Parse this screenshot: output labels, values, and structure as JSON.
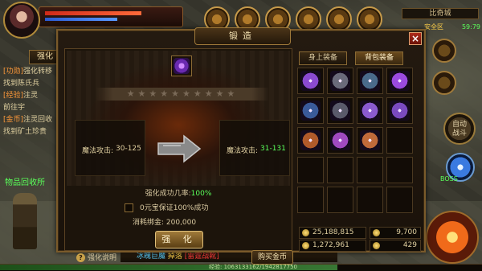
{
  "hud": {
    "map_name": "比奇城",
    "zone_label": "安全区",
    "coords": "59:79",
    "fight_label_1": "自动",
    "fight_label_2": "战斗",
    "pet_text": "BOSS",
    "item_recycle": "物品回收所"
  },
  "quest_panel": {
    "tab_label": "强化",
    "lines": [
      {
        "tag": "[功勋]",
        "text": "强化转移"
      },
      {
        "tag": "",
        "text": "找到陈氏兵"
      },
      {
        "tag": "[经验]",
        "text": "注灵"
      },
      {
        "tag": "",
        "text": "前往宇"
      },
      {
        "tag": "[金币]",
        "text": "注灵回收"
      },
      {
        "tag": "",
        "text": "找到矿土珍贵"
      }
    ],
    "side_tabs": [
      "强化转移",
      "注灵",
      "注灵回收"
    ]
  },
  "bottom": {
    "loot_a": "冰魄巨魔",
    "loot_b": "掉落",
    "loot_c": "[雷霆战靴]",
    "exp_text": "经验: 1063133162/1942817750"
  },
  "forge": {
    "title": "锻造",
    "close": "×",
    "stars": "★★★★★★★★★★",
    "stat_left_label": "魔法攻击:",
    "stat_left_value": "30-125",
    "stat_right_label": "魔法攻击:",
    "stat_right_value": "31-131",
    "rate_label": "强化成功几率:",
    "rate_value": "100%",
    "rate_fraction": 1.0,
    "guarantee": "0元宝保证100%成功",
    "cost": "消耗绑金: 200,000",
    "enhance": "强 化",
    "help": "强化说明",
    "buy_gold": "购买金币"
  },
  "inventory": {
    "tab_equipped": "身上装备",
    "tab_bag": "背包装备",
    "items": [
      {
        "name": "ring-icon",
        "color": "#8a4ad0"
      },
      {
        "name": "helmet-icon",
        "color": "#6a6a7a"
      },
      {
        "name": "armor-icon",
        "color": "#4a6a8a"
      },
      {
        "name": "necklace-icon",
        "color": "#9a4ae0"
      },
      {
        "name": "armor-icon",
        "color": "#3a5a9a"
      },
      {
        "name": "helmet-icon",
        "color": "#5a5a6a"
      },
      {
        "name": "gauntlet-icon",
        "color": "#8a5ad0"
      },
      {
        "name": "bracer-icon",
        "color": "#7a4ac0"
      },
      {
        "name": "boots-icon",
        "color": "#b05a2a"
      },
      {
        "name": "belt-icon",
        "color": "#a04ac0"
      },
      {
        "name": "boots-icon",
        "color": "#c06a3a"
      },
      {
        "name": "empty",
        "color": ""
      },
      {
        "name": "empty",
        "color": ""
      },
      {
        "name": "empty",
        "color": ""
      },
      {
        "name": "empty",
        "color": ""
      },
      {
        "name": "empty",
        "color": ""
      },
      {
        "name": "empty",
        "color": ""
      },
      {
        "name": "empty",
        "color": ""
      },
      {
        "name": "empty",
        "color": ""
      },
      {
        "name": "empty",
        "color": ""
      }
    ],
    "gold": "25,188,815",
    "bound_gold": "1,272,961",
    "yuanbao": "9,700",
    "bound_yuanbao": "429"
  }
}
